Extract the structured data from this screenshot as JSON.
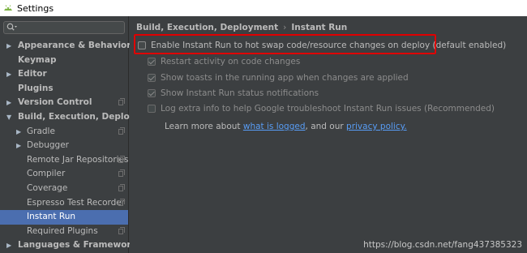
{
  "window": {
    "title": "Settings"
  },
  "search": {
    "placeholder": "",
    "value": ""
  },
  "sidebar": {
    "items": [
      {
        "label": "Appearance & Behavior",
        "arrow": "▶",
        "bold": true,
        "child": false,
        "copy": false,
        "selected": false
      },
      {
        "label": "Keymap",
        "arrow": "",
        "bold": true,
        "child": false,
        "copy": false,
        "selected": false
      },
      {
        "label": "Editor",
        "arrow": "▶",
        "bold": true,
        "child": false,
        "copy": false,
        "selected": false
      },
      {
        "label": "Plugins",
        "arrow": "",
        "bold": true,
        "child": false,
        "copy": false,
        "selected": false
      },
      {
        "label": "Version Control",
        "arrow": "▶",
        "bold": true,
        "child": false,
        "copy": true,
        "selected": false
      },
      {
        "label": "Build, Execution, Deployment",
        "arrow": "▼",
        "bold": true,
        "child": false,
        "copy": false,
        "selected": false
      },
      {
        "label": "Gradle",
        "arrow": "▶",
        "bold": false,
        "child": true,
        "copy": true,
        "selected": false
      },
      {
        "label": "Debugger",
        "arrow": "▶",
        "bold": false,
        "child": true,
        "copy": false,
        "selected": false
      },
      {
        "label": "Remote Jar Repositories",
        "arrow": "",
        "bold": false,
        "child": true,
        "copy": true,
        "selected": false
      },
      {
        "label": "Compiler",
        "arrow": "",
        "bold": false,
        "child": true,
        "copy": true,
        "selected": false
      },
      {
        "label": "Coverage",
        "arrow": "",
        "bold": false,
        "child": true,
        "copy": true,
        "selected": false
      },
      {
        "label": "Espresso Test Recorder",
        "arrow": "",
        "bold": false,
        "child": true,
        "copy": true,
        "selected": false
      },
      {
        "label": "Instant Run",
        "arrow": "",
        "bold": false,
        "child": true,
        "copy": false,
        "selected": true
      },
      {
        "label": "Required Plugins",
        "arrow": "",
        "bold": false,
        "child": true,
        "copy": true,
        "selected": false
      },
      {
        "label": "Languages & Frameworks",
        "arrow": "▶",
        "bold": true,
        "child": false,
        "copy": false,
        "selected": false
      }
    ]
  },
  "breadcrumb": {
    "parent": "Build, Execution, Deployment",
    "separator": "›",
    "current": "Instant Run"
  },
  "options": {
    "enable": {
      "label": "Enable Instant Run to hot swap code/resource changes on deploy (default enabled)",
      "checked": false
    },
    "restart": {
      "label": "Restart activity on code changes",
      "checked": true
    },
    "toasts": {
      "label": "Show toasts in the running app when changes are applied",
      "checked": true
    },
    "notifications": {
      "label": "Show Instant Run status notifications",
      "checked": true
    },
    "log": {
      "label": "Log extra info to help Google troubleshoot Instant Run issues (Recommended)",
      "checked": false
    }
  },
  "learn": {
    "prefix": "Learn more about ",
    "link1": "what is logged",
    "middle": ", and our ",
    "link2": "privacy policy."
  },
  "watermark": "https://blog.csdn.net/fang437385323",
  "colors": {
    "highlight": "#e00000",
    "selected": "#4b6eaf",
    "link": "#589df6",
    "background": "#3c3f41"
  }
}
